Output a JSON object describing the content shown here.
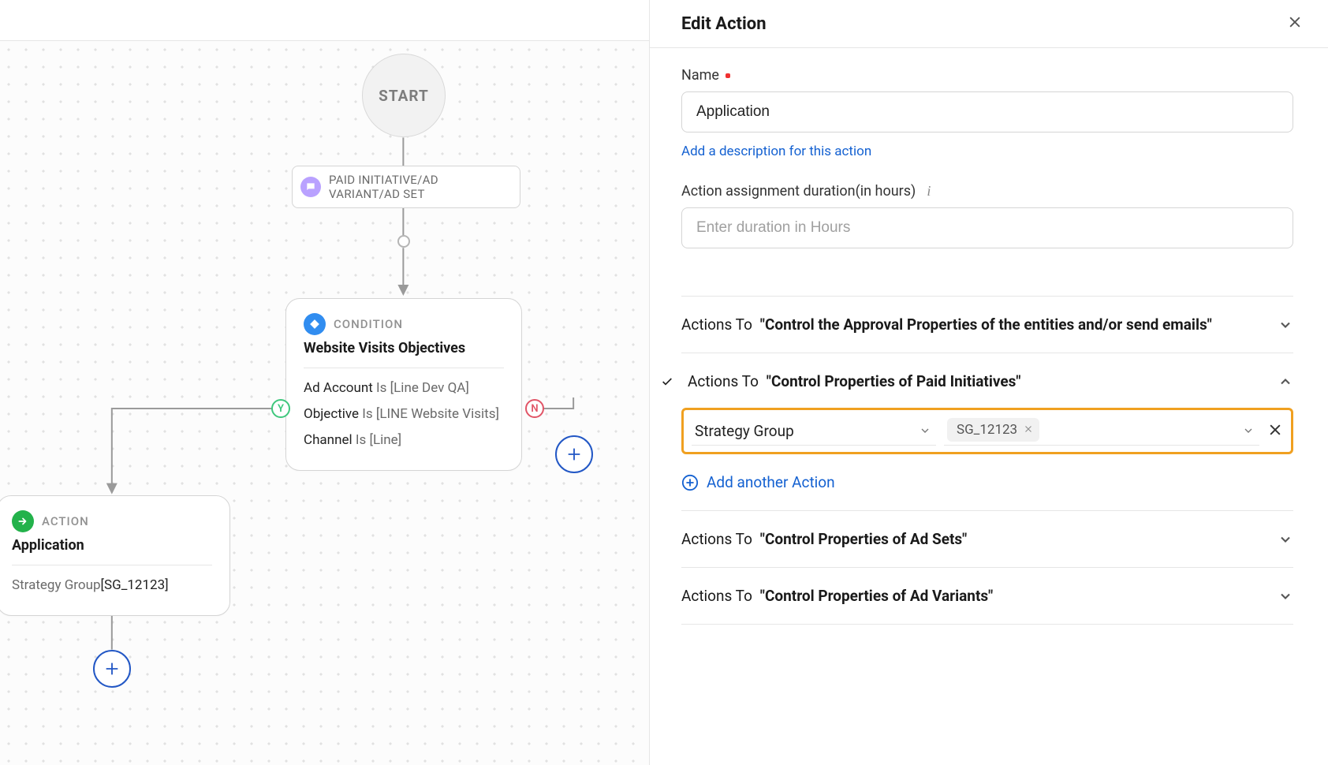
{
  "panel": {
    "title": "Edit Action",
    "name_label": "Name",
    "name_value": "Application",
    "add_desc_link": "Add a description for this action",
    "duration_label": "Action assignment duration(in hours)",
    "duration_placeholder": "Enter duration in Hours",
    "sections": {
      "approval": {
        "pre": "Actions To ",
        "bold": "\"Control the Approval Properties of the entities and/or send emails\"",
        "expanded": false,
        "checked": false
      },
      "paid": {
        "pre": "Actions To ",
        "bold": "\"Control Properties of Paid Initiatives\"",
        "expanded": true,
        "checked": true,
        "property_select": "Strategy Group",
        "chip_value": "SG_12123",
        "add_another": "Add another Action"
      },
      "adsets": {
        "pre": "Actions To ",
        "bold": "\"Control Properties of Ad Sets\"",
        "expanded": false,
        "checked": false
      },
      "advariants": {
        "pre": "Actions To ",
        "bold": "\"Control Properties of Ad Variants\"",
        "expanded": false,
        "checked": false
      }
    }
  },
  "canvas": {
    "start_label": "START",
    "entity_pill": "PAID INITIATIVE/AD VARIANT/AD SET",
    "condition": {
      "tag": "CONDITION",
      "title": "Website Visits Objectives",
      "rows": [
        {
          "key": "Ad Account",
          "op": "Is",
          "val": "[Line Dev QA]"
        },
        {
          "key": "Objective",
          "op": "Is",
          "val": "[LINE Website Visits]"
        },
        {
          "key": "Channel",
          "op": "Is",
          "val": "[Line]"
        }
      ],
      "yes": "Y",
      "no": "N"
    },
    "action": {
      "tag": "ACTION",
      "title": "Application",
      "row_key": "Strategy Group",
      "row_val": "[SG_12123]"
    }
  }
}
